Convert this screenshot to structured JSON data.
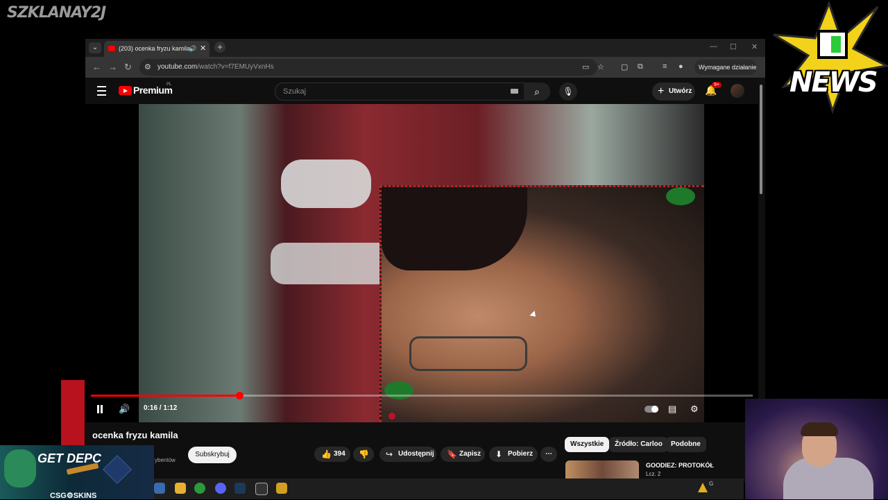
{
  "overlay": {
    "watermark": "SZKLANAY2J",
    "news_logo_text": "NEWS",
    "ad_headline": "GET DEPC",
    "ad_brand": "CSG⚙SKINS",
    "tray_text": "G"
  },
  "browser": {
    "tab_title": "(203) ocenka fryzu kamila -",
    "url_host": "youtube.com",
    "url_path": "/watch?v=f7EMUyVxnHs",
    "profile_button": "Wymagane działanie"
  },
  "youtube": {
    "brand": "Premium",
    "country": "PL",
    "search_placeholder": "Szukaj",
    "create_label": "Utwórz",
    "notification_count": "9+"
  },
  "player": {
    "current_time": "0:16",
    "duration": "1:12",
    "time_display": "0:16 / 1:12",
    "progress_fraction": 0.224
  },
  "video": {
    "title": "ocenka fryzu kamila",
    "channel_subscribers": "ybentów",
    "subscribe_label": "Subskrybuj",
    "like_count": "394",
    "share_label": "Udostępnij",
    "save_label": "Zapisz",
    "download_label": "Pobierz"
  },
  "chips": [
    "Wszystkie",
    "Źródło: Carloo",
    "Podobne"
  ],
  "recommendation": {
    "title": "GOODIEZ: PROTOKÓŁ",
    "subtitle": "Lcz. 2"
  },
  "colors": {
    "accent": "#ff0000",
    "background": "#0f0f0f",
    "pill": "#272727"
  }
}
